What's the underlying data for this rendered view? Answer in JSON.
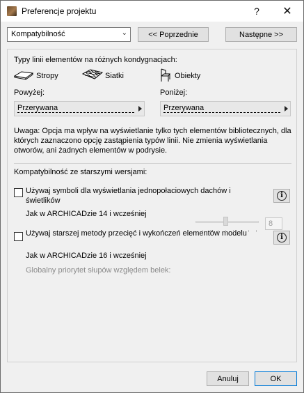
{
  "window": {
    "title": "Preferencje projektu",
    "help_symbol": "?",
    "close_symbol": "✕",
    "app_icon": "archicad-icon"
  },
  "top": {
    "combo_value": "Kompatybilność",
    "prev_label": "<< Poprzednie",
    "next_label": "Następne >>"
  },
  "line_types": {
    "heading": "Typy linii elementów na różnych kondygnacjach:",
    "elements": [
      {
        "label": "Stropy",
        "icon": "slab-icon"
      },
      {
        "label": "Siatki",
        "icon": "mesh-icon"
      },
      {
        "label": "Obiekty",
        "icon": "object-chair-icon"
      }
    ],
    "above_label": "Powyżej:",
    "above_value": "Przerywana",
    "below_label": "Poniżej:",
    "below_value": "Przerywana",
    "note": "Uwaga: Opcja ma wpływ na wyświetlanie tylko tych elementów bibliotecznych, dla których zaznaczono opcję zastąpienia typów linii. Nie zmienia wyświetlania otworów, ani żadnych elementów w podrysie."
  },
  "compat": {
    "heading": "Kompatybilność ze starszymi wersjami:",
    "option1": {
      "label": "Używaj symboli dla wyświetlania jednopołaciowych dachów i świetlików",
      "sub": "Jak w ARCHICADzie 14 i wcześniej",
      "checked": false
    },
    "option2": {
      "label": "Używaj starszej metody przecięć i wykończeń elementów modelu",
      "sub": "Jak w ARCHICADzie 16 i wcześniej",
      "checked": false
    },
    "priority_label": "Globalny priorytet słupów względem belek:",
    "priority_value": "8",
    "priority_fraction": 0.45
  },
  "footer": {
    "cancel_label": "Anuluj",
    "ok_label": "OK"
  }
}
